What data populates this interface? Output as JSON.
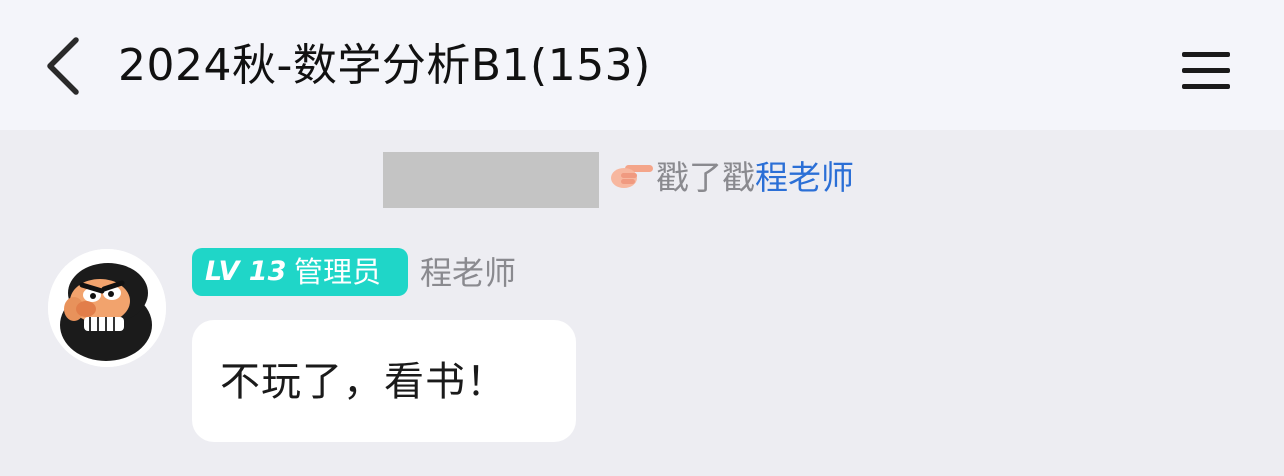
{
  "header": {
    "title": "2024秋-数学分析B1(153)",
    "back_icon": "chevron-left-icon",
    "menu_icon": "hamburger-menu-icon"
  },
  "notice": {
    "action_text": "戳了戳",
    "target_name": "程老师",
    "icon": "pointing-hand-icon",
    "redacted": true
  },
  "message": {
    "badge_level": "LV 13",
    "badge_role": "管理员",
    "sender_name": "程老师",
    "text": "不玩了，看书！",
    "avatar": "cartoon-bearded-man-avatar"
  },
  "colors": {
    "header_bg": "#f4f5fa",
    "chat_bg": "#ededf2",
    "badge_bg": "#1fd6c8",
    "link_blue": "#2b6fd6",
    "muted_text": "#8a8a8f",
    "redaction_gray": "#c4c4c4"
  }
}
